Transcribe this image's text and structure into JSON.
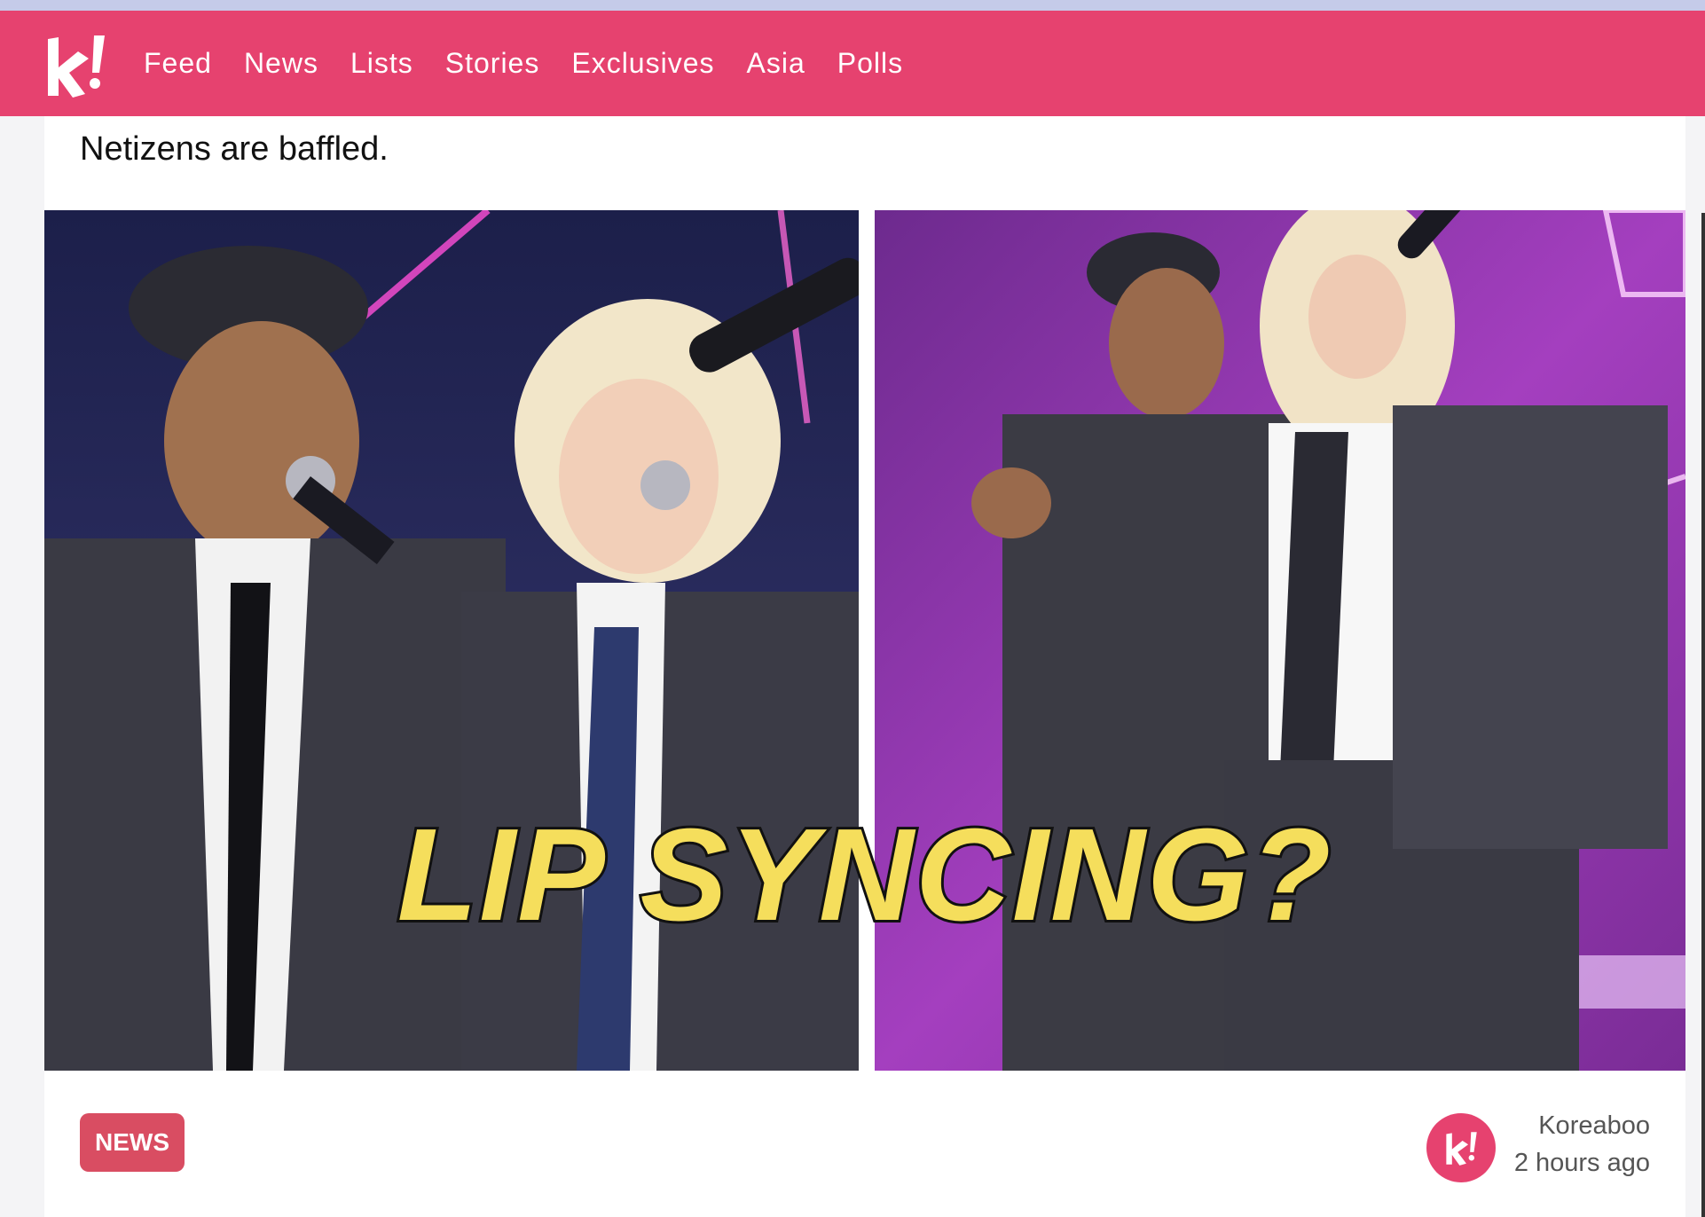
{
  "colors": {
    "brand": "#e6426f",
    "badge": "#d94d62",
    "top_strip": "#c5cbe9"
  },
  "nav": {
    "logo_icon": "koreaboo-k-logo",
    "items": [
      "Feed",
      "News",
      "Lists",
      "Stories",
      "Exclusives",
      "Asia",
      "Polls"
    ]
  },
  "article": {
    "subtitle": "Netizens are baffled.",
    "hero_caption": "LIP SYNCING?",
    "category_badge": "NEWS",
    "author": "Koreaboo",
    "time": "2 hours ago"
  }
}
